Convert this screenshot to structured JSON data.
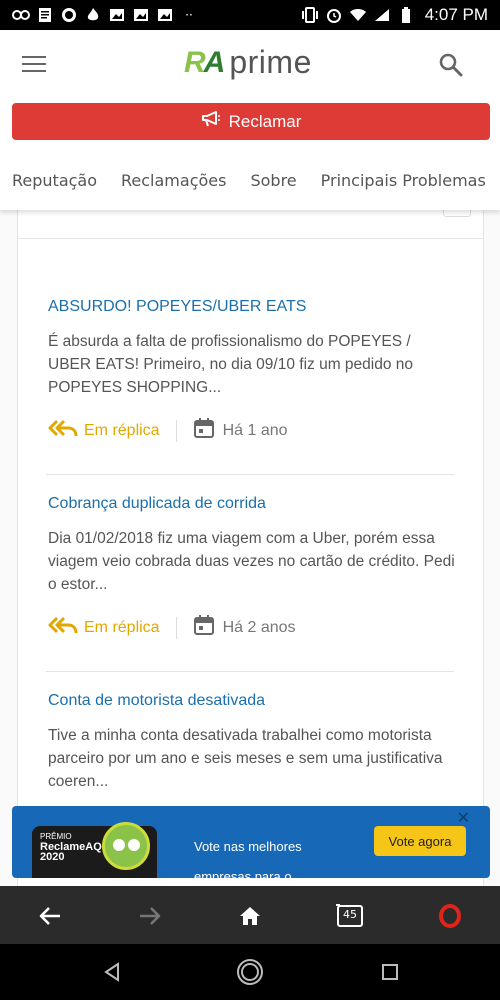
{
  "status_bar": {
    "time": "4:07 PM",
    "left_icons": [
      "link-icon",
      "document-icon",
      "whatsapp-icon",
      "flame-icon",
      "image-icon",
      "image-icon",
      "image-icon",
      "more-icon"
    ],
    "right_icons": [
      "vibrate-icon",
      "alarm-icon",
      "wifi-icon",
      "signal-icon",
      "battery-icon"
    ]
  },
  "header": {
    "logo_mark": "RA",
    "logo_text": "prime",
    "reclamar_label": "Reclamar"
  },
  "tabs": [
    "Reputação",
    "Reclamações",
    "Sobre",
    "Principais Problemas"
  ],
  "complaints": [
    {
      "title": "ABSURDO! POPEYES/UBER EATS",
      "description": "É absurda a falta de profissionalismo do POPEYES / UBER EATS! Primeiro, no dia 09/10 fiz um pedido no POPEYES SHOPPING...",
      "status": "Em réplica",
      "date": "Há 1 ano"
    },
    {
      "title": "Cobrança duplicada de corrida",
      "description": "Dia 01/02/2018 fiz uma viagem com a Uber, porém essa viagem veio cobrada duas vezes no cartão de crédito. Pedi o estor...",
      "status": "Em réplica",
      "date": "Há 2 anos"
    },
    {
      "title": "Conta de motorista desativada",
      "description": "Tive a minha conta desativada trabalhei como motorista parceiro por um ano e seis meses e sem uma justificativa coeren..."
    }
  ],
  "banner": {
    "badge_line1": "PRÊMIO",
    "badge_line2": "ReclameAQUI",
    "badge_year": "2020",
    "text_line1": "Vote nas melhores",
    "text_line2": "empresas para o",
    "cta": "Vote agora"
  },
  "browser": {
    "tabs_count": "45"
  },
  "colors": {
    "accent_red": "#de3b36",
    "link_blue": "#1b6fad",
    "replica_yellow": "#e0a800",
    "banner_blue": "#1769b8",
    "cta_yellow": "#f5c518"
  }
}
